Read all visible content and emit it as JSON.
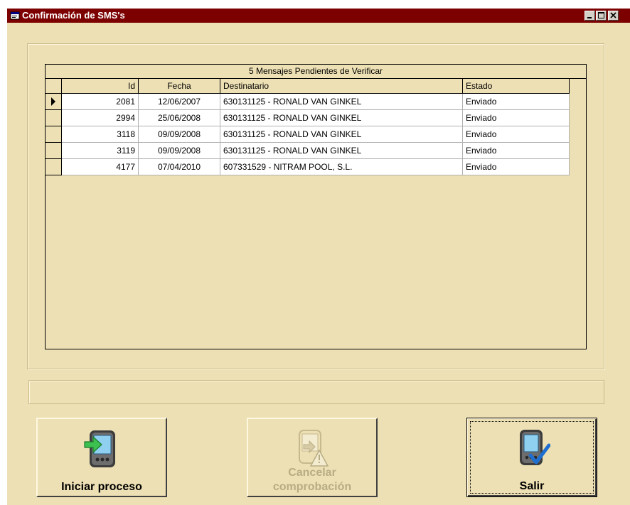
{
  "window": {
    "title": "Confirmación de SMS's",
    "colors": {
      "titlebar": "#7d0000",
      "background": "#ede0b4"
    }
  },
  "grid": {
    "caption": "5 Mensajes Pendientes de Verificar",
    "columns": [
      "Id",
      "Fecha",
      "Destinatario",
      "Estado"
    ],
    "rows": [
      {
        "id": "2081",
        "fecha": "12/06/2007",
        "destinatario": "630131125 - RONALD VAN GINKEL",
        "estado": "Enviado"
      },
      {
        "id": "2994",
        "fecha": "25/06/2008",
        "destinatario": "630131125 - RONALD VAN GINKEL",
        "estado": "Enviado"
      },
      {
        "id": "3118",
        "fecha": "09/09/2008",
        "destinatario": "630131125 - RONALD VAN GINKEL",
        "estado": "Enviado"
      },
      {
        "id": "3119",
        "fecha": "09/09/2008",
        "destinatario": "630131125 - RONALD VAN GINKEL",
        "estado": "Enviado"
      },
      {
        "id": "4177",
        "fecha": "07/04/2010",
        "destinatario": "607331529 - NITRAM POOL, S.L.",
        "estado": "Enviado"
      }
    ],
    "current_row_marker": "row-pointer-icon"
  },
  "status": {
    "text": ""
  },
  "buttons": {
    "start": {
      "label": "Iniciar proceso",
      "icon": "pda-arrow-icon"
    },
    "cancel": {
      "label_line1": "Cancelar",
      "label_line2": "comprobación",
      "icon": "pda-warning-icon",
      "disabled": true
    },
    "exit": {
      "label": "Salir",
      "icon": "pda-check-icon"
    }
  }
}
